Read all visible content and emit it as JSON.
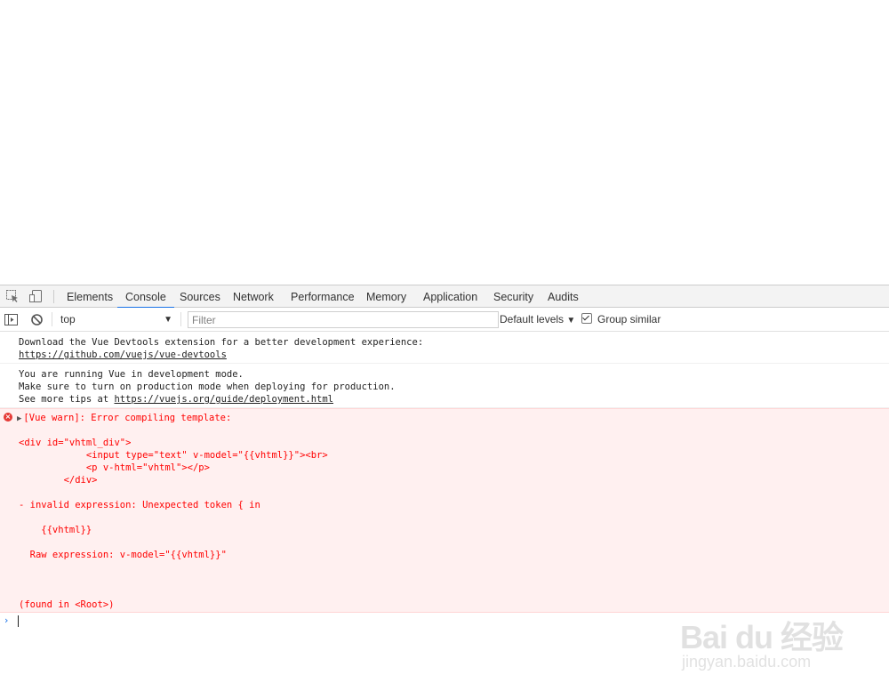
{
  "devtools": {
    "tabs": [
      {
        "label": "Elements"
      },
      {
        "label": "Console",
        "active": true
      },
      {
        "label": "Sources"
      },
      {
        "label": "Network"
      },
      {
        "label": "Performance"
      },
      {
        "label": "Memory"
      },
      {
        "label": "Application"
      },
      {
        "label": "Security"
      },
      {
        "label": "Audits"
      }
    ],
    "icons": {
      "inspect": "inspect-element-icon",
      "device": "device-toolbar-icon",
      "sidebar": "console-sidebar-icon",
      "clear": "clear-console-icon"
    },
    "accent_color": "#1a73e8"
  },
  "console_toolbar": {
    "context": "top",
    "filter_placeholder": "Filter",
    "levels": "Default levels",
    "group_similar": "Group similar",
    "group_similar_checked": true
  },
  "messages": [
    {
      "type": "log",
      "lines": [
        "Download the Vue Devtools extension for a better development experience:"
      ],
      "link": "https://github.com/vuejs/vue-devtools"
    },
    {
      "type": "log",
      "lines": [
        "You are running Vue in development mode.",
        "Make sure to turn on production mode when deploying for production."
      ],
      "prefix": "See more tips at ",
      "link": "https://vuejs.org/guide/deployment.html"
    },
    {
      "type": "error",
      "color": "#ff0000",
      "header": "[Vue warn]: Error compiling template:",
      "lines": [
        "",
        "<div id=\"vhtml_div\">",
        "            <input type=\"text\" v-model=\"{{vhtml}}\"><br>",
        "            <p v-html=\"vhtml\"></p>",
        "        </div>",
        "",
        "- invalid expression: Unexpected token { in",
        "",
        "    {{vhtml}}",
        "",
        "  Raw expression: v-model=\"{{vhtml}}\"",
        "",
        "",
        "",
        "(found in <Root>)"
      ]
    }
  ],
  "watermark": {
    "logo": "Bai du 经验",
    "url": "jingyan.baidu.com"
  }
}
